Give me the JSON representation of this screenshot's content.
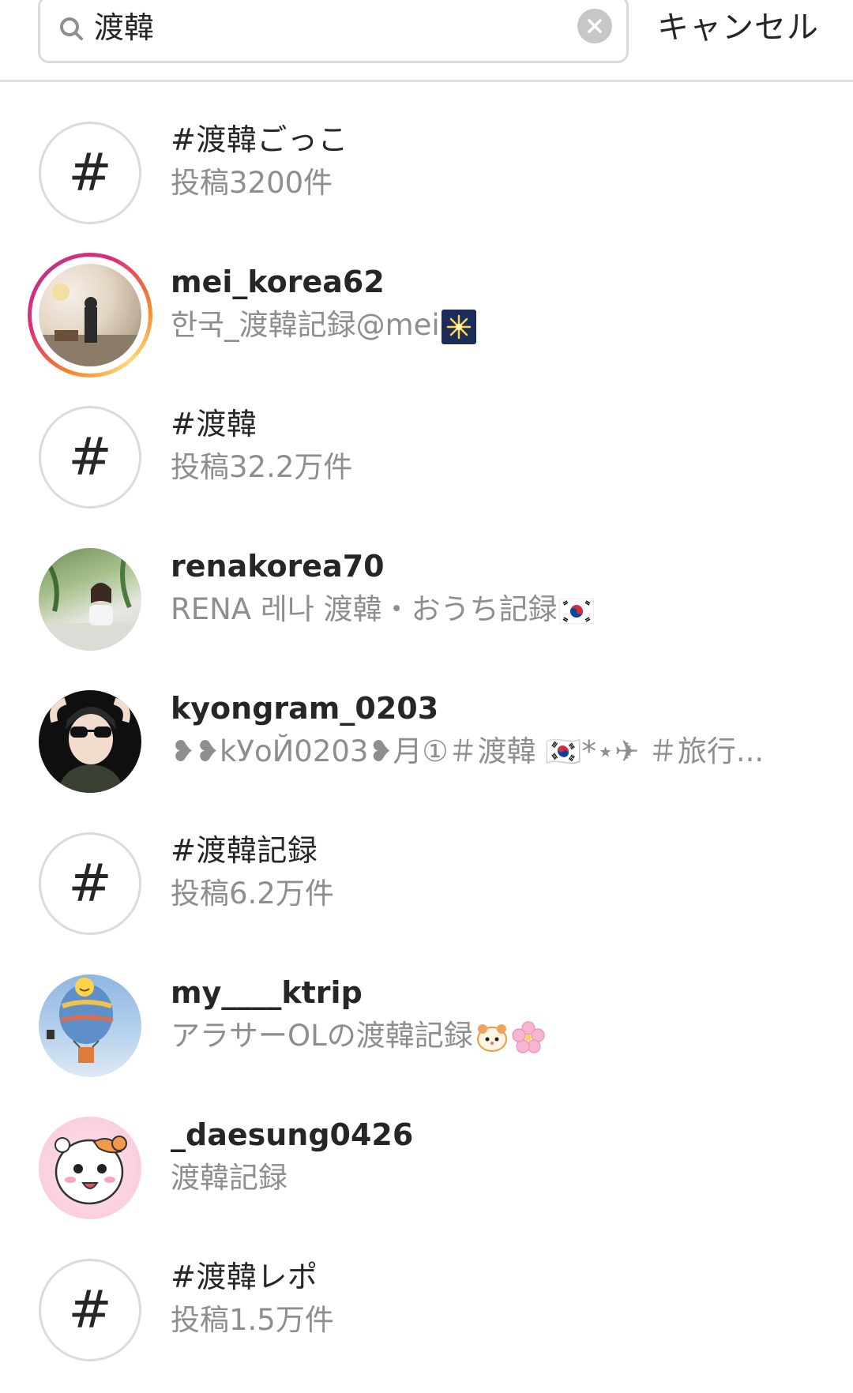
{
  "search": {
    "query": "渡韓",
    "icon": "search-icon",
    "clear_icon": "clear-icon",
    "cancel_label": "キャンセル"
  },
  "results": [
    {
      "kind": "hashtag",
      "title": "#渡韓ごっこ",
      "subtitle": "投稿3200件"
    },
    {
      "kind": "user",
      "title": "mei_korea62",
      "subtitle": "한국_渡韓記録@mei",
      "has_story": true,
      "emoji": "fireworks"
    },
    {
      "kind": "hashtag",
      "title": "#渡韓",
      "subtitle": "投稿32.2万件"
    },
    {
      "kind": "user",
      "title": "renakorea70",
      "subtitle": "RENA 레나 渡韓・おうち記録",
      "emoji": "korean-flag"
    },
    {
      "kind": "user",
      "title": "kyongram_0203",
      "subtitle": "❥❥kУoЙ0203❥月①＃渡韓 🇰🇷*⋆✈ ＃旅行..."
    },
    {
      "kind": "hashtag",
      "title": "#渡韓記録",
      "subtitle": "投稿6.2万件"
    },
    {
      "kind": "user",
      "title": "my____ktrip",
      "subtitle": "アラサーOLの渡韓記録",
      "emoji": "hamster-and-blossom"
    },
    {
      "kind": "user",
      "title": "_daesung0426",
      "subtitle": "渡韓記録"
    },
    {
      "kind": "hashtag",
      "title": "#渡韓レポ",
      "subtitle": "投稿1.5万件"
    }
  ],
  "hash_glyph": "#"
}
